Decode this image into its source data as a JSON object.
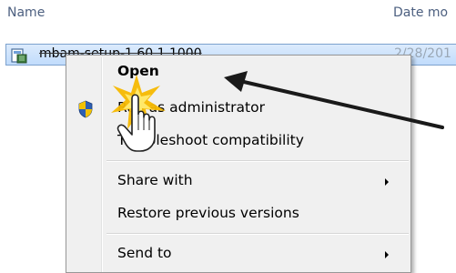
{
  "explorer": {
    "columns": {
      "name": "Name",
      "date": "Date mo"
    },
    "file": {
      "name": "mbam-setup-1.60.1.1000",
      "date": "2/28/201",
      "icon": "installer-icon"
    }
  },
  "context_menu": {
    "items": [
      {
        "label": "Open",
        "bold": true
      },
      {
        "label": "Run as administrator",
        "icon": "uac-shield-icon"
      },
      {
        "label": "Troubleshoot compatibility"
      },
      {
        "label": "Share with",
        "submenu": true
      },
      {
        "label": "Restore previous versions"
      },
      {
        "label": "Send to",
        "submenu": true
      }
    ]
  },
  "annotation": {
    "icons": [
      "arrow-icon",
      "click-burst-icon",
      "hand-cursor-icon"
    ]
  },
  "colors": {
    "selection": "#c1dcfc",
    "selection_border": "#7da2ce",
    "menu_background": "#f0f0f0",
    "burst": "#f5b800"
  }
}
